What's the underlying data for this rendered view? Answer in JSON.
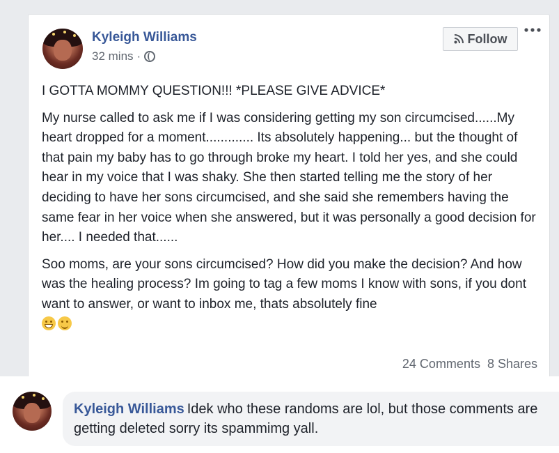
{
  "post": {
    "author": "Kyleigh Williams",
    "time": "32 mins",
    "separator": "·",
    "privacy_icon": "globe-icon",
    "follow_label": "Follow",
    "follow_icon": "rss-icon",
    "more_icon": "more-options-icon",
    "title": "I GOTTA MOMMY QUESTION!!! *PLEASE GIVE ADVICE*",
    "paragraph1": "My nurse called to ask me if I was considering getting my son circumcised......My heart dropped for a moment............. Its absolutely happening... but the thought of that pain my baby has to go through broke my heart. I told her yes, and she could hear in my voice that I was shaky. She then started telling me the story of her deciding to have her sons circumcised, and she said she remembers having the same fear in her voice when she answered, but it was personally a good decision for her.... I needed that......",
    "paragraph2": "Soo moms, are your sons circumcised? How did you make the decision? And how was the healing process? Im going to tag a few moms I know with sons, if you dont want to answer, or want to inbox me, thats absolutely fine",
    "emojis": [
      "grinning-squinting-emoji",
      "smiling-emoji"
    ],
    "comments_count": "24 Comments",
    "shares_count": "8 Shares"
  },
  "comment": {
    "author": "Kyleigh Williams",
    "text": "Idek who these randoms are lol, but those comments are getting deleted sorry its spammimg yall."
  },
  "colors": {
    "link_blue": "#385898",
    "background": "#e9ebee",
    "secondary_text": "#616770"
  }
}
